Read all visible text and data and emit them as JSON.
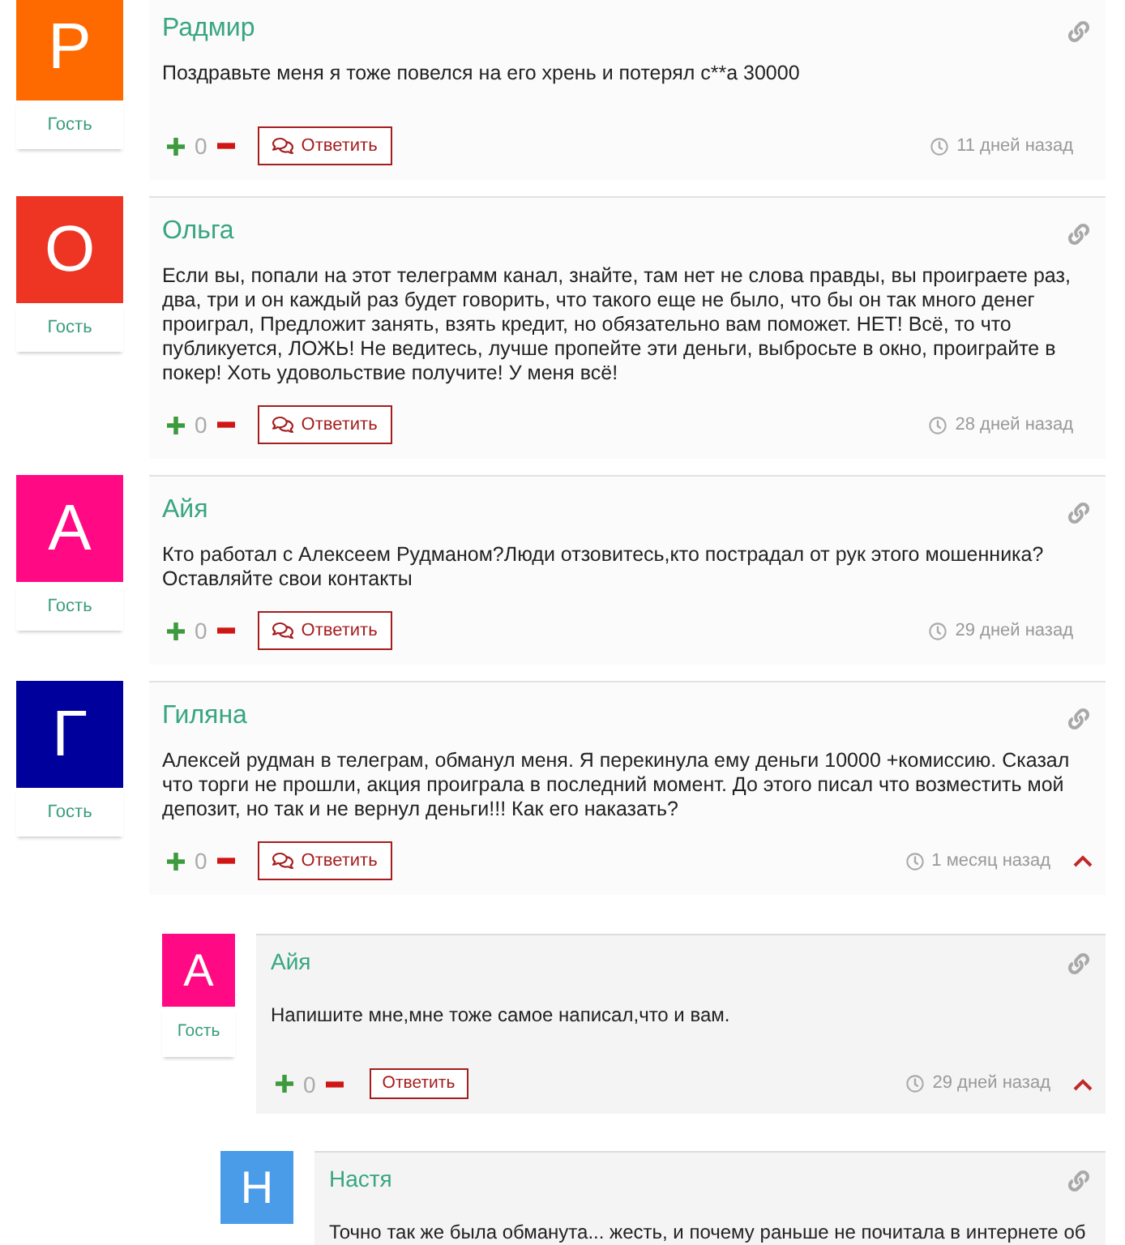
{
  "comments": [
    {
      "avatar_letter": "Р",
      "color": "#ff6a00",
      "name": "Радмир",
      "role": "Гость",
      "text": "Поздравьте меня я тоже повелся на его хрень и потерял с**а 30000",
      "votes": "0",
      "reply_label": "Ответить",
      "time": "11 дней назад"
    },
    {
      "avatar_letter": "О",
      "color": "#ee3524",
      "name": "Ольга",
      "role": "Гость",
      "text": "Если вы, попали на этот телеграмм канал, знайте, там нет не слова правды, вы проиграете раз, два, три и он каждый раз будет говорить, что такого еще не было, что бы он так много денег проиграл, Предложит занять, взять кредит, но обязательно вам поможет. НЕТ! Всё, то что публикуется, ЛОЖЬ! Не ведитесь, лучше пропейте эти деньги, выбросьте в окно, проиграйте в покер! Хоть удовольствие получите! У меня всё!",
      "votes": "0",
      "reply_label": "Ответить",
      "time": "28 дней назад"
    },
    {
      "avatar_letter": "А",
      "color": "#ff0a84",
      "name": "Айя",
      "role": "Гость",
      "text": "Кто работал с Алексеем Рудманом?Люди отзовитесь,кто пострадал от рук этого мошенника? Оставляйте свои контакты",
      "votes": "0",
      "reply_label": "Ответить",
      "time": "29 дней назад"
    },
    {
      "avatar_letter": "Г",
      "color": "#00009c",
      "name": "Гиляна",
      "role": "Гость",
      "text": "Алексей рудман в телеграм, обманул меня. Я перекинула ему деньги 10000 +комиссию. Сказал что торги не прошли, акция проиграла в последний момент. До этого писал что возместить мой депозит, но так и не вернул деньги!!! Как его наказать?",
      "votes": "0",
      "reply_label": "Ответить",
      "time": "1 месяц назад",
      "expanded": true,
      "replies": [
        {
          "avatar_letter": "А",
          "color": "#ff0a84",
          "name": "Айя",
          "role": "Гость",
          "text": "Напишите мне,мне тоже самое написал,что и вам.",
          "votes": "0",
          "reply_label": "Ответить",
          "time": "29 дней назад",
          "expanded": true,
          "replies": [
            {
              "avatar_letter": "Н",
              "color": "#4a9be8",
              "name": "Настя",
              "text": "Точно так же была обманута... жесть, и почему раньше не почитала в интернете об"
            }
          ]
        }
      ]
    }
  ]
}
